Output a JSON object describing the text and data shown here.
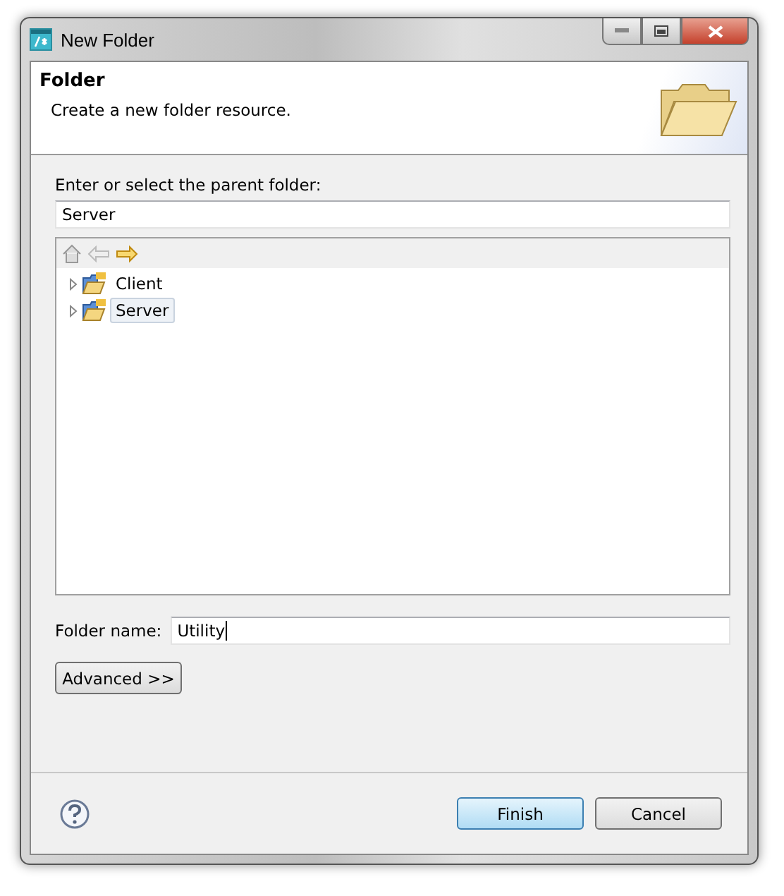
{
  "window": {
    "title": "New Folder"
  },
  "header": {
    "title": "Folder",
    "description": "Create a new folder resource."
  },
  "parent_label": {
    "text": "Enter or select the parent folder:"
  },
  "parent_field": {
    "value": "Server"
  },
  "tree": {
    "items": [
      {
        "label": "Client",
        "expanded": false,
        "selected": false
      },
      {
        "label": "Server",
        "expanded": false,
        "selected": true
      }
    ]
  },
  "folder_name": {
    "label": "Folder name:",
    "value": "Utility"
  },
  "advanced_button": {
    "label": "Advanced >>"
  },
  "buttons": [
    {
      "label": "Finish",
      "default": true
    },
    {
      "label": "Cancel",
      "default": false
    }
  ]
}
